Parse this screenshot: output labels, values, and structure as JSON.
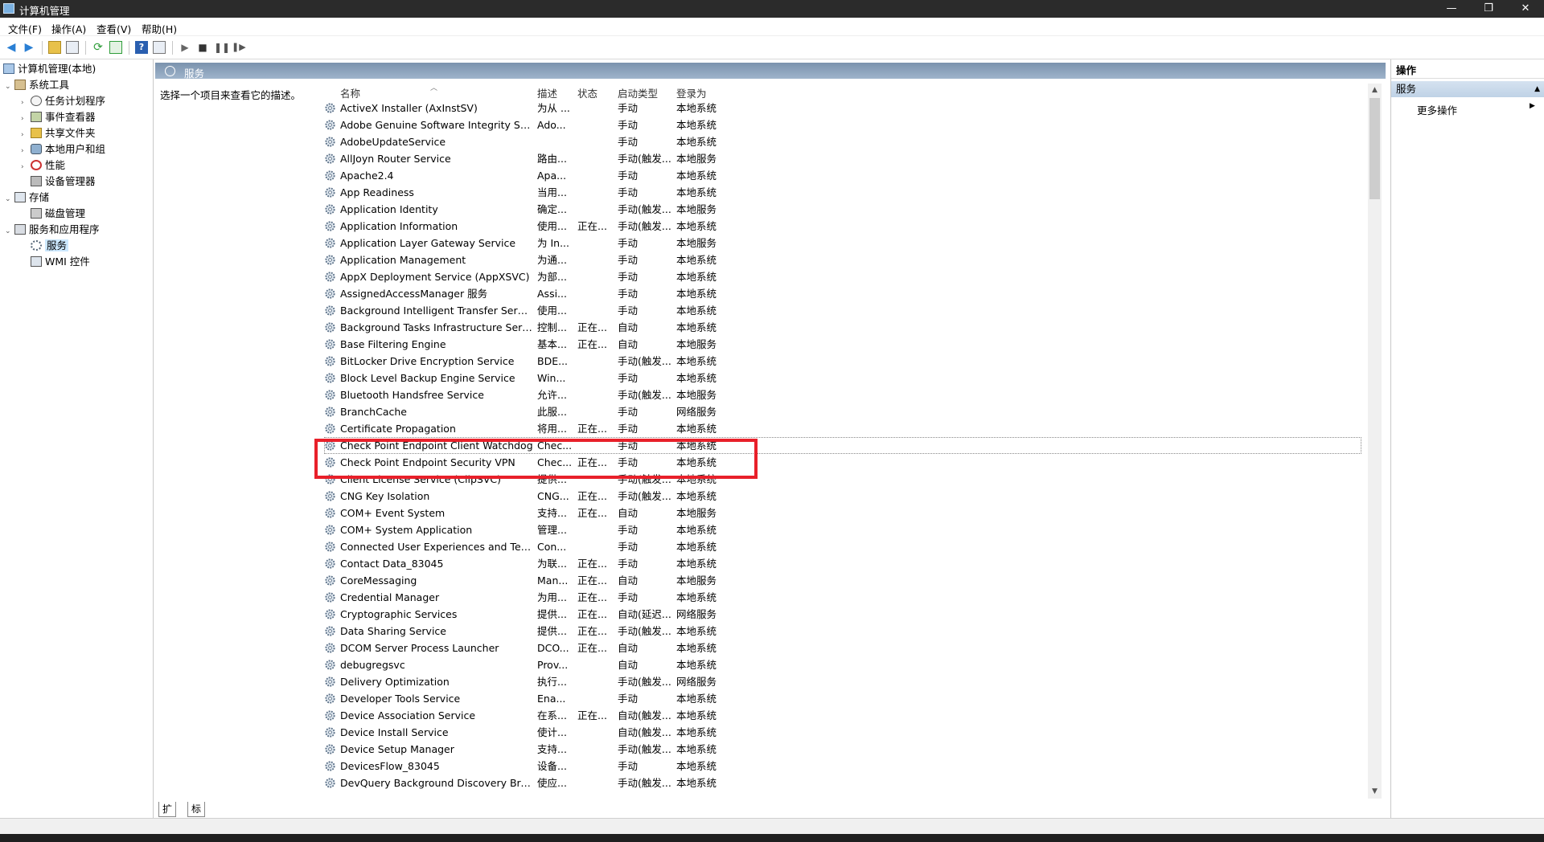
{
  "window": {
    "title": "计算机管理",
    "controls": {
      "minimize": "—",
      "maximize": "❐",
      "close": "✕"
    }
  },
  "menu": [
    "文件(F)",
    "操作(A)",
    "查看(V)",
    "帮助(H)"
  ],
  "tree": {
    "root": "计算机管理(本地)",
    "system_tools": "系统工具",
    "task_scheduler": "任务计划程序",
    "event_viewer": "事件查看器",
    "shared_folders": "共享文件夹",
    "local_users": "本地用户和组",
    "performance": "性能",
    "device_manager": "设备管理器",
    "storage": "存储",
    "disk_management": "磁盘管理",
    "services_apps": "服务和应用程序",
    "services": "服务",
    "wmi": "WMI 控件"
  },
  "center": {
    "header": "服务",
    "description": "选择一个项目来查看它的描述。",
    "columns": {
      "name": "名称",
      "desc": "描述",
      "status": "状态",
      "startup": "启动类型",
      "logon": "登录为"
    }
  },
  "services": [
    {
      "name": "ActiveX Installer (AxInstSV)",
      "desc": "为从 ...",
      "status": "",
      "startup": "手动",
      "logon": "本地系统"
    },
    {
      "name": "Adobe Genuine Software Integrity Servi...",
      "desc": "Ado...",
      "status": "",
      "startup": "手动",
      "logon": "本地系统"
    },
    {
      "name": "AdobeUpdateService",
      "desc": "",
      "status": "",
      "startup": "手动",
      "logon": "本地系统"
    },
    {
      "name": "AllJoyn Router Service",
      "desc": "路由...",
      "status": "",
      "startup": "手动(触发...",
      "logon": "本地服务"
    },
    {
      "name": "Apache2.4",
      "desc": "Apa...",
      "status": "",
      "startup": "手动",
      "logon": "本地系统"
    },
    {
      "name": "App Readiness",
      "desc": "当用...",
      "status": "",
      "startup": "手动",
      "logon": "本地系统"
    },
    {
      "name": "Application Identity",
      "desc": "确定...",
      "status": "",
      "startup": "手动(触发...",
      "logon": "本地服务"
    },
    {
      "name": "Application Information",
      "desc": "使用...",
      "status": "正在...",
      "startup": "手动(触发...",
      "logon": "本地系统"
    },
    {
      "name": "Application Layer Gateway Service",
      "desc": "为 In...",
      "status": "",
      "startup": "手动",
      "logon": "本地服务"
    },
    {
      "name": "Application Management",
      "desc": "为通...",
      "status": "",
      "startup": "手动",
      "logon": "本地系统"
    },
    {
      "name": "AppX Deployment Service (AppXSVC)",
      "desc": "为部...",
      "status": "",
      "startup": "手动",
      "logon": "本地系统"
    },
    {
      "name": "AssignedAccessManager 服务",
      "desc": "Assi...",
      "status": "",
      "startup": "手动",
      "logon": "本地系统"
    },
    {
      "name": "Background Intelligent Transfer Service",
      "desc": "使用...",
      "status": "",
      "startup": "手动",
      "logon": "本地系统"
    },
    {
      "name": "Background Tasks Infrastructure Service",
      "desc": "控制...",
      "status": "正在...",
      "startup": "自动",
      "logon": "本地系统"
    },
    {
      "name": "Base Filtering Engine",
      "desc": "基本...",
      "status": "正在...",
      "startup": "自动",
      "logon": "本地服务"
    },
    {
      "name": "BitLocker Drive Encryption Service",
      "desc": "BDE...",
      "status": "",
      "startup": "手动(触发...",
      "logon": "本地系统"
    },
    {
      "name": "Block Level Backup Engine Service",
      "desc": "Win...",
      "status": "",
      "startup": "手动",
      "logon": "本地系统"
    },
    {
      "name": "Bluetooth Handsfree Service",
      "desc": "允许...",
      "status": "",
      "startup": "手动(触发...",
      "logon": "本地服务"
    },
    {
      "name": "BranchCache",
      "desc": "此服...",
      "status": "",
      "startup": "手动",
      "logon": "网络服务"
    },
    {
      "name": "Certificate Propagation",
      "desc": "将用...",
      "status": "正在...",
      "startup": "手动",
      "logon": "本地系统"
    },
    {
      "name": "Check Point Endpoint Client Watchdog",
      "desc": "Chec...",
      "status": "",
      "startup": "手动",
      "logon": "本地系统"
    },
    {
      "name": "Check Point Endpoint Security VPN",
      "desc": "Chec...",
      "status": "正在...",
      "startup": "手动",
      "logon": "本地系统"
    },
    {
      "name": "Client License Service (ClipSVC)",
      "desc": "提供...",
      "status": "",
      "startup": "手动(触发...",
      "logon": "本地系统"
    },
    {
      "name": "CNG Key Isolation",
      "desc": "CNG...",
      "status": "正在...",
      "startup": "手动(触发...",
      "logon": "本地系统"
    },
    {
      "name": "COM+ Event System",
      "desc": "支持...",
      "status": "正在...",
      "startup": "自动",
      "logon": "本地服务"
    },
    {
      "name": "COM+ System Application",
      "desc": "管理...",
      "status": "",
      "startup": "手动",
      "logon": "本地系统"
    },
    {
      "name": "Connected User Experiences and Telem...",
      "desc": "Con...",
      "status": "",
      "startup": "手动",
      "logon": "本地系统"
    },
    {
      "name": "Contact Data_83045",
      "desc": "为联...",
      "status": "正在...",
      "startup": "手动",
      "logon": "本地系统"
    },
    {
      "name": "CoreMessaging",
      "desc": "Man...",
      "status": "正在...",
      "startup": "自动",
      "logon": "本地服务"
    },
    {
      "name": "Credential Manager",
      "desc": "为用...",
      "status": "正在...",
      "startup": "手动",
      "logon": "本地系统"
    },
    {
      "name": "Cryptographic Services",
      "desc": "提供...",
      "status": "正在...",
      "startup": "自动(延迟...",
      "logon": "网络服务"
    },
    {
      "name": "Data Sharing Service",
      "desc": "提供...",
      "status": "正在...",
      "startup": "手动(触发...",
      "logon": "本地系统"
    },
    {
      "name": "DCOM Server Process Launcher",
      "desc": "DCO...",
      "status": "正在...",
      "startup": "自动",
      "logon": "本地系统"
    },
    {
      "name": "debugregsvc",
      "desc": "Prov...",
      "status": "",
      "startup": "自动",
      "logon": "本地系统"
    },
    {
      "name": "Delivery Optimization",
      "desc": "执行...",
      "status": "",
      "startup": "手动(触发...",
      "logon": "网络服务"
    },
    {
      "name": "Developer Tools Service",
      "desc": "Ena...",
      "status": "",
      "startup": "手动",
      "logon": "本地系统"
    },
    {
      "name": "Device Association Service",
      "desc": "在系...",
      "status": "正在...",
      "startup": "自动(触发...",
      "logon": "本地系统"
    },
    {
      "name": "Device Install Service",
      "desc": "使计...",
      "status": "",
      "startup": "自动(触发...",
      "logon": "本地系统"
    },
    {
      "name": "Device Setup Manager",
      "desc": "支持...",
      "status": "",
      "startup": "手动(触发...",
      "logon": "本地系统"
    },
    {
      "name": "DevicesFlow_83045",
      "desc": "设备...",
      "status": "",
      "startup": "手动",
      "logon": "本地系统"
    },
    {
      "name": "DevQuery Background Discovery Broker",
      "desc": "使应...",
      "status": "",
      "startup": "手动(触发...",
      "logon": "本地系统"
    }
  ],
  "tabs": [
    "扩展",
    "标准"
  ],
  "actions": {
    "header": "操作",
    "section": "服务",
    "more": "更多操作"
  },
  "colors": {
    "highlight_box": "#e8202a",
    "header_bar": "#8ea6bf",
    "selected": "#cce8ff"
  }
}
